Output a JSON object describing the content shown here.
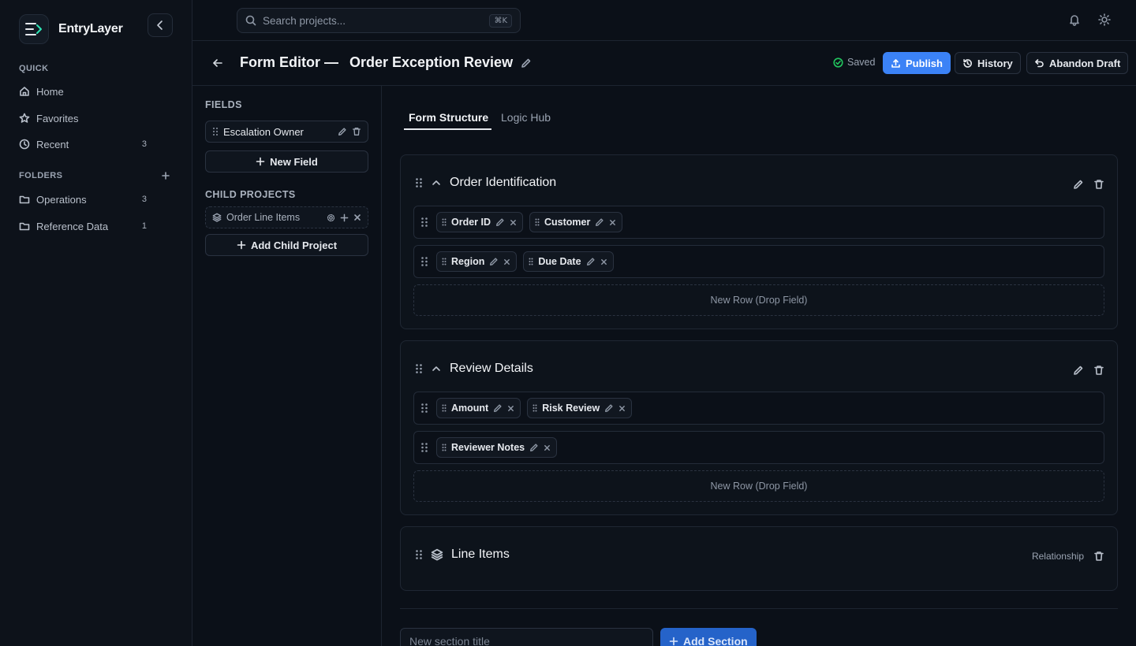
{
  "app": {
    "name": "EntryLayer"
  },
  "sidebar": {
    "quick_label": "QUICK",
    "quick_items": [
      {
        "label": "Home",
        "icon": "home-icon",
        "count": ""
      },
      {
        "label": "Favorites",
        "icon": "star-icon",
        "count": ""
      },
      {
        "label": "Recent",
        "icon": "clock-icon",
        "count": "3"
      }
    ],
    "folders_label": "FOLDERS",
    "folders": [
      {
        "label": "Operations",
        "icon": "folder-icon",
        "count": "3"
      },
      {
        "label": "Reference Data",
        "icon": "folder-icon",
        "count": "1"
      }
    ]
  },
  "topbar": {
    "search_placeholder": "Search projects...",
    "search_shortcut": "⌘K"
  },
  "header": {
    "title_prefix": "Form Editor —",
    "title_name": "Order Exception Review",
    "saved_label": "Saved",
    "publish_label": "Publish",
    "history_label": "History",
    "abandon_label": "Abandon Draft"
  },
  "fields_panel": {
    "fields_label": "FIELDS",
    "fields": [
      {
        "name": "Escalation Owner"
      }
    ],
    "new_field_label": "New Field",
    "child_projects_label": "CHILD PROJECTS",
    "child_projects": [
      {
        "name": "Order Line Items"
      }
    ],
    "add_child_label": "Add Child Project"
  },
  "tabs": {
    "structure": "Form Structure",
    "logic": "Logic Hub"
  },
  "sections": [
    {
      "title": "Order Identification",
      "rows": [
        [
          "Order ID",
          "Customer"
        ],
        [
          "Region",
          "Due Date"
        ]
      ],
      "drop_label": "New Row (Drop Field)"
    },
    {
      "title": "Review Details",
      "rows": [
        [
          "Amount",
          "Risk Review"
        ],
        [
          "Reviewer Notes"
        ]
      ],
      "drop_label": "New Row (Drop Field)"
    },
    {
      "title": "Line Items",
      "relationship_label": "Relationship"
    }
  ],
  "footer": {
    "new_section_placeholder": "New section title",
    "add_section_label": "Add Section"
  },
  "colors": {
    "background": "#0b1018",
    "accent": "#3b82f6",
    "brand": "#2ee6b6",
    "saved_check": "#22c55e"
  }
}
